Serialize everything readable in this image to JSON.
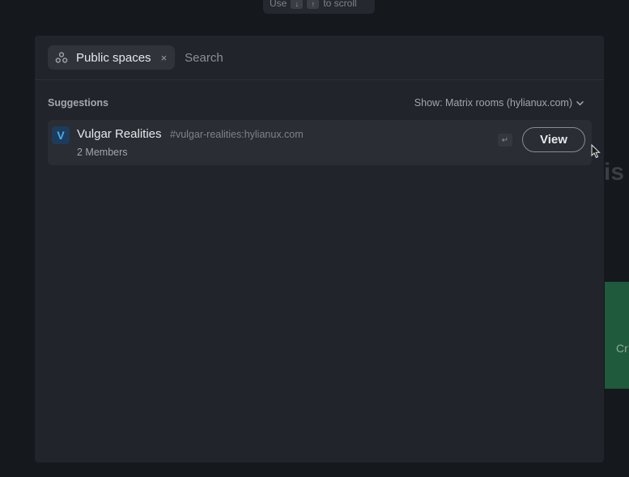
{
  "background": {
    "title_fragment": "is",
    "button_fragment": "Cr",
    "scroll_hint": {
      "prefix": "Use",
      "key_down": "↓",
      "key_up": "↑",
      "suffix": "to scroll"
    }
  },
  "dialog": {
    "filter": {
      "icon": "spaces-icon",
      "label": "Public spaces",
      "close_glyph": "×"
    },
    "search": {
      "placeholder": "Search",
      "value": ""
    },
    "suggestions": {
      "title": "Suggestions",
      "show_filter_label": "Show: Matrix rooms (hylianux.com)",
      "chevron": "chevron-down-icon"
    },
    "results": [
      {
        "avatar_letter": "V",
        "name": "Vulgar Realities",
        "alias": "#vulgar-realities:hylianux.com",
        "members": "2 Members",
        "enter_hint": "↵",
        "action_label": "View"
      }
    ]
  },
  "colors": {
    "background": "#15181d",
    "dialog": "#21242a",
    "row": "#2a2d33",
    "avatar_bg": "#1d3b5a",
    "avatar_fg": "#43b1f0",
    "green_button": "#1f5a3c"
  }
}
